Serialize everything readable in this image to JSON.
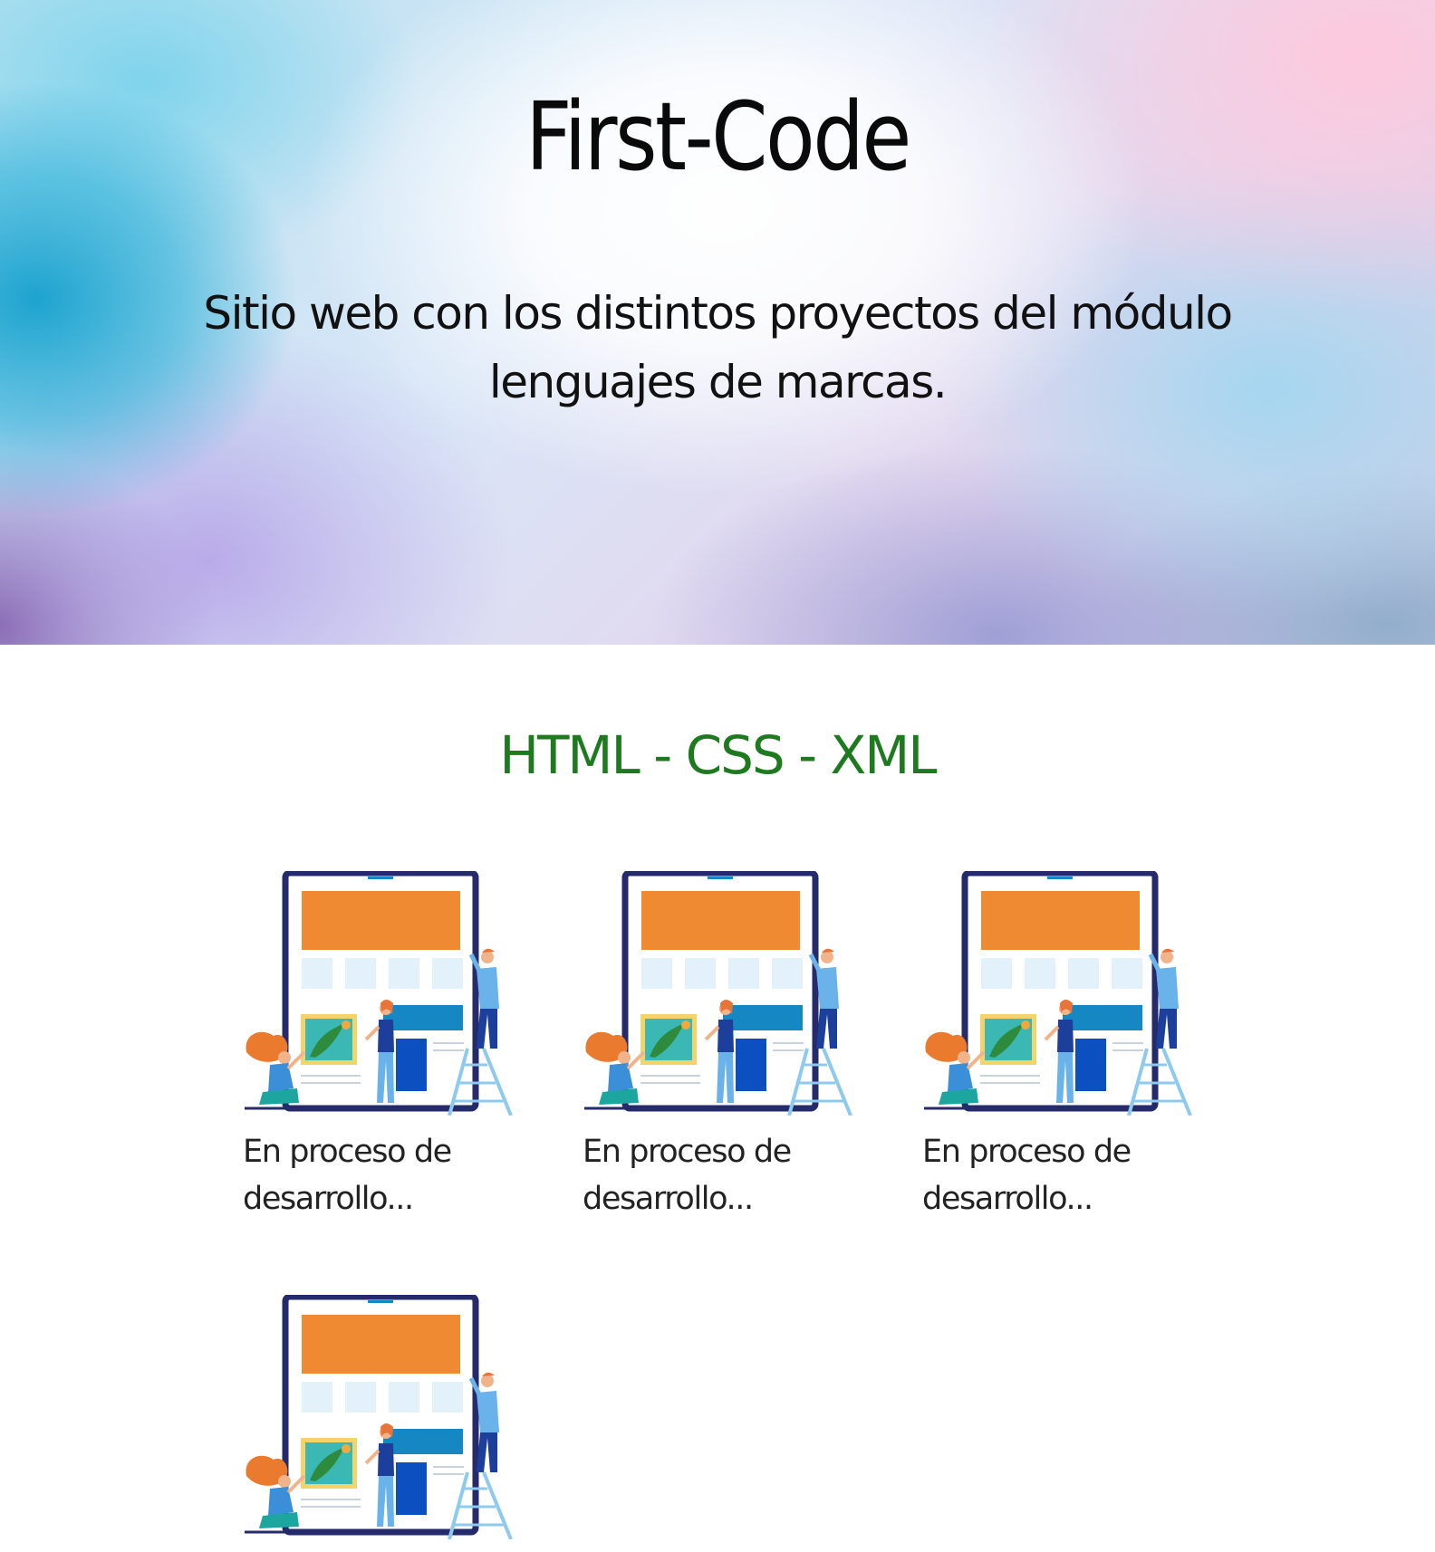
{
  "hero": {
    "title": "First-Code",
    "subtitle": "Sitio web con los distintos proyectos del módulo lenguajes de marcas."
  },
  "section": {
    "title": "HTML - CSS - XML"
  },
  "cards": [
    {
      "caption": "En proceso de desarrollo...",
      "image": "website-building-illustration"
    },
    {
      "caption": "En proceso de desarrollo...",
      "image": "website-building-illustration"
    },
    {
      "caption": "En proceso de desarrollo...",
      "image": "website-building-illustration"
    },
    {
      "caption": "",
      "image": "website-building-illustration"
    }
  ],
  "colors": {
    "section_title": "#1e7a1e",
    "frame": "#252a6b",
    "header_block": "#f08a32",
    "banner": "#1588c4",
    "figure_blue": "#3a8fd8"
  }
}
